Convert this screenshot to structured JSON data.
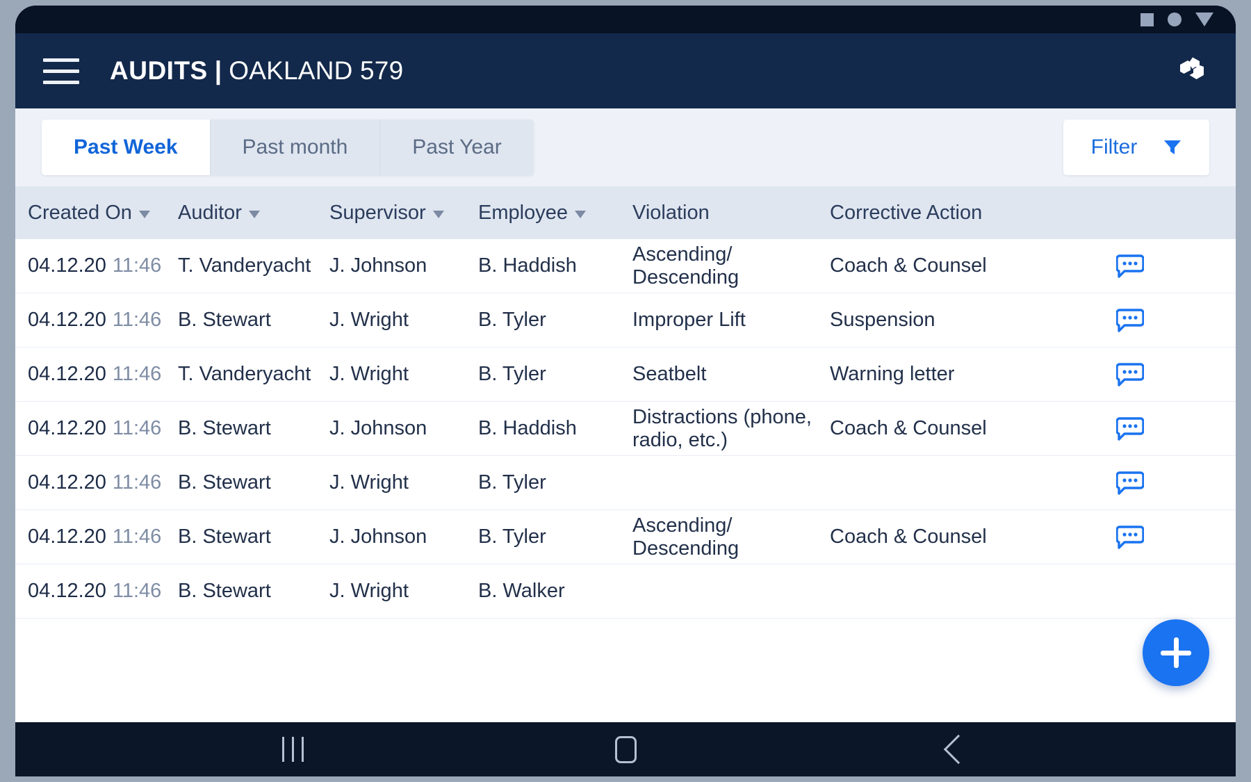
{
  "statusbar": {
    "icons": [
      "square-icon",
      "circle-icon",
      "triangle-down-icon"
    ]
  },
  "appbar": {
    "menu_icon": "hamburger-menu-icon",
    "title_bold": "AUDITS",
    "title_separator": "|",
    "title_light": "OAKLAND 579",
    "logo_icon": "brand-hexagon-refresh-icon"
  },
  "tabs": [
    {
      "label": "Past Week",
      "active": true
    },
    {
      "label": "Past month",
      "active": false
    },
    {
      "label": "Past Year",
      "active": false
    }
  ],
  "filter": {
    "label": "Filter",
    "icon": "funnel-icon",
    "accent": "#1a6cdd"
  },
  "table": {
    "columns": [
      {
        "label": "Created On",
        "sortable": true
      },
      {
        "label": "Auditor",
        "sortable": true
      },
      {
        "label": "Supervisor",
        "sortable": true
      },
      {
        "label": "Employee",
        "sortable": true
      },
      {
        "label": "Violation",
        "sortable": false
      },
      {
        "label": "Corrective Action",
        "sortable": false
      }
    ],
    "rows": [
      {
        "date": "04.12.20",
        "time": "11:46",
        "auditor": "T. Vanderyacht",
        "supervisor": "J. Johnson",
        "employee": "B. Haddish",
        "violation": "Ascending/ Descending",
        "corrective": "Coach & Counsel",
        "chat": true
      },
      {
        "date": "04.12.20",
        "time": "11:46",
        "auditor": "B. Stewart",
        "supervisor": "J. Wright",
        "employee": "B. Tyler",
        "violation": "Improper Lift",
        "corrective": "Suspension",
        "chat": true
      },
      {
        "date": "04.12.20",
        "time": "11:46",
        "auditor": "T. Vanderyacht",
        "supervisor": "J. Wright",
        "employee": "B. Tyler",
        "violation": "Seatbelt",
        "corrective": "Warning letter",
        "chat": true
      },
      {
        "date": "04.12.20",
        "time": "11:46",
        "auditor": "B. Stewart",
        "supervisor": "J. Johnson",
        "employee": "B. Haddish",
        "violation": "Distractions (phone, radio, etc.)",
        "corrective": "Coach & Counsel",
        "chat": true
      },
      {
        "date": "04.12.20",
        "time": "11:46",
        "auditor": "B. Stewart",
        "supervisor": "J. Wright",
        "employee": "B. Tyler",
        "violation": "",
        "corrective": "",
        "chat": true
      },
      {
        "date": "04.12.20",
        "time": "11:46",
        "auditor": "B. Stewart",
        "supervisor": "J. Johnson",
        "employee": "B. Tyler",
        "violation": "Ascending/ Descending",
        "corrective": "Coach & Counsel",
        "chat": true
      },
      {
        "date": "04.12.20",
        "time": "11:46",
        "auditor": "B. Stewart",
        "supervisor": "J. Wright",
        "employee": "B. Walker",
        "violation": "",
        "corrective": "",
        "chat": false
      }
    ],
    "row_action_icon": "chat-bubble-icon"
  },
  "fab": {
    "icon": "plus-icon",
    "color": "#1a73f0"
  },
  "navbar": {
    "recents_icon": "recents-icon",
    "home_icon": "home-icon",
    "back_icon": "back-icon"
  },
  "colors": {
    "appbar": "#13294b",
    "statusbar": "#091326",
    "accent_blue": "#1165d8",
    "header_row": "#dfe6f0",
    "page_bg": "#eef2f8"
  }
}
